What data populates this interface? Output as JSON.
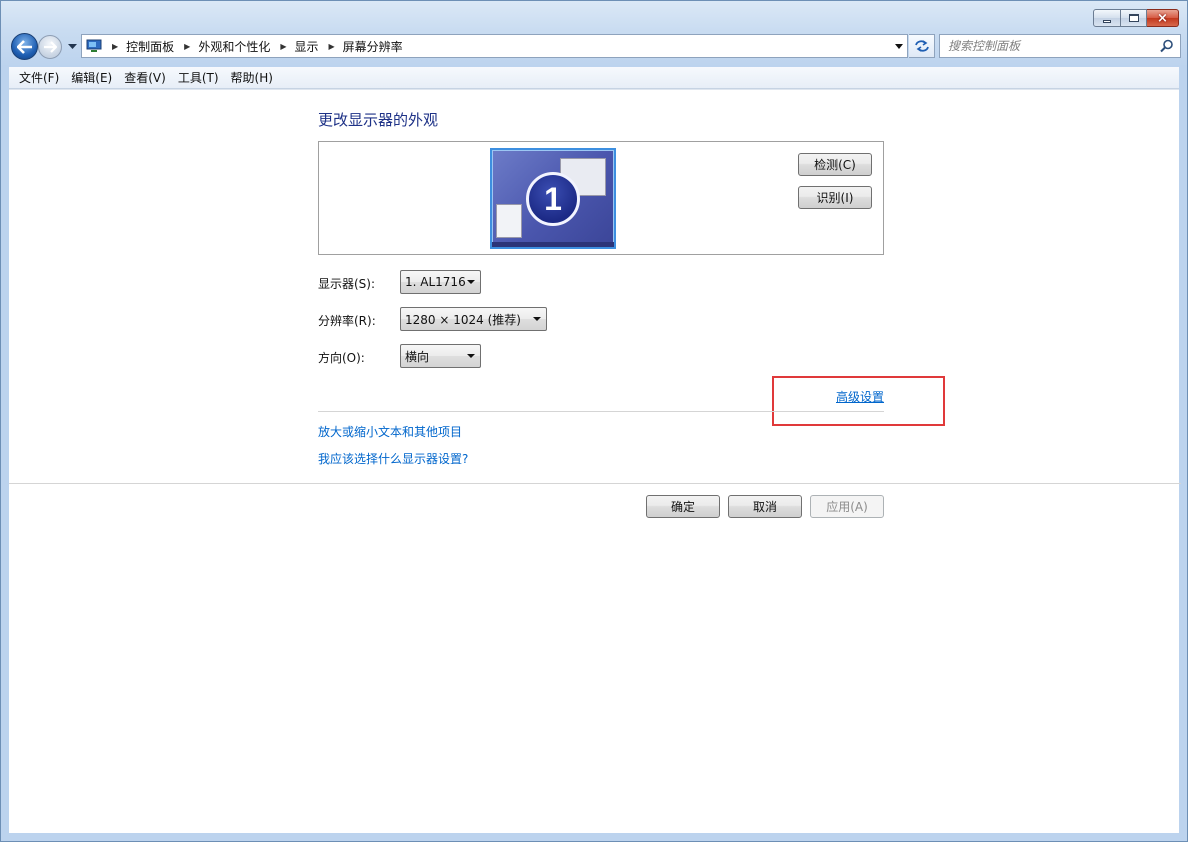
{
  "window": {
    "caption": {
      "minimize": "minimize",
      "maximize": "maximize",
      "close": "×"
    }
  },
  "address_bar": {
    "breadcrumbs": [
      "控制面板",
      "外观和个性化",
      "显示",
      "屏幕分辨率"
    ],
    "search_placeholder": "搜索控制面板"
  },
  "menu": {
    "items": [
      "文件(F)",
      "编辑(E)",
      "查看(V)",
      "工具(T)",
      "帮助(H)"
    ]
  },
  "main": {
    "title": "更改显示器的外观",
    "monitor_number": "1",
    "detect_button": "检测(C)",
    "identify_button": "识别(I)",
    "display_label": "显示器(S):",
    "display_value": "1. AL1716",
    "resolution_label": "分辨率(R):",
    "resolution_value": "1280 × 1024 (推荐)",
    "orientation_label": "方向(O):",
    "orientation_value": "横向",
    "advanced_link": "高级设置",
    "link_text_size": "放大或缩小文本和其他项目",
    "link_which_settings": "我应该选择什么显示器设置?"
  },
  "footer": {
    "ok": "确定",
    "cancel": "取消",
    "apply": "应用(A)"
  },
  "colors": {
    "title_blue": "#1e3287",
    "link_blue": "#0066cc",
    "highlight_red": "#e0393a"
  },
  "icons": [
    "back-arrow-icon",
    "forward-arrow-icon",
    "computer-icon",
    "refresh-icon",
    "search-icon",
    "chevron-down-icon"
  ]
}
